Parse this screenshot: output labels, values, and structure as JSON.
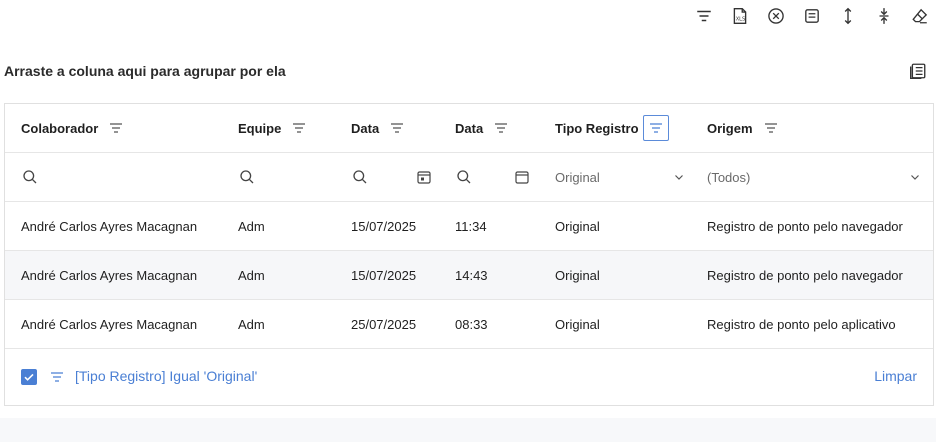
{
  "group_panel": {
    "text": "Arraste a coluna aqui para agrupar por ela"
  },
  "toolbar": {
    "icons": [
      "filter-lines-icon",
      "export-xls-icon",
      "clear-circle-icon",
      "document-icon",
      "expand-vertical-icon",
      "collapse-vertical-icon",
      "eraser-icon"
    ]
  },
  "columns": [
    {
      "label": "Colaborador"
    },
    {
      "label": "Equipe"
    },
    {
      "label": "Data"
    },
    {
      "label": "Data"
    },
    {
      "label": "Tipo Registro"
    },
    {
      "label": "Origem"
    }
  ],
  "filters": {
    "tipo_registro": "Original",
    "origem": "(Todos)"
  },
  "rows": [
    [
      "André Carlos Ayres Macagnan",
      "Adm",
      "15/07/2025",
      "11:34",
      "Original",
      "Registro de ponto pelo navegador"
    ],
    [
      "André Carlos Ayres Macagnan",
      "Adm",
      "15/07/2025",
      "14:43",
      "Original",
      "Registro de ponto pelo navegador"
    ],
    [
      "André Carlos Ayres Macagnan",
      "Adm",
      "25/07/2025",
      "08:33",
      "Original",
      "Registro de ponto pelo aplicativo"
    ]
  ],
  "filter_panel": {
    "expression": "[Tipo Registro] Igual 'Original'",
    "clear_label": "Limpar",
    "enabled": true
  },
  "colors": {
    "accent": "#4a7fd4",
    "text": "#1f1f1f",
    "muted": "#6a6a6a",
    "border": "#e0e0e0",
    "alt_row": "#f6f7f9"
  }
}
